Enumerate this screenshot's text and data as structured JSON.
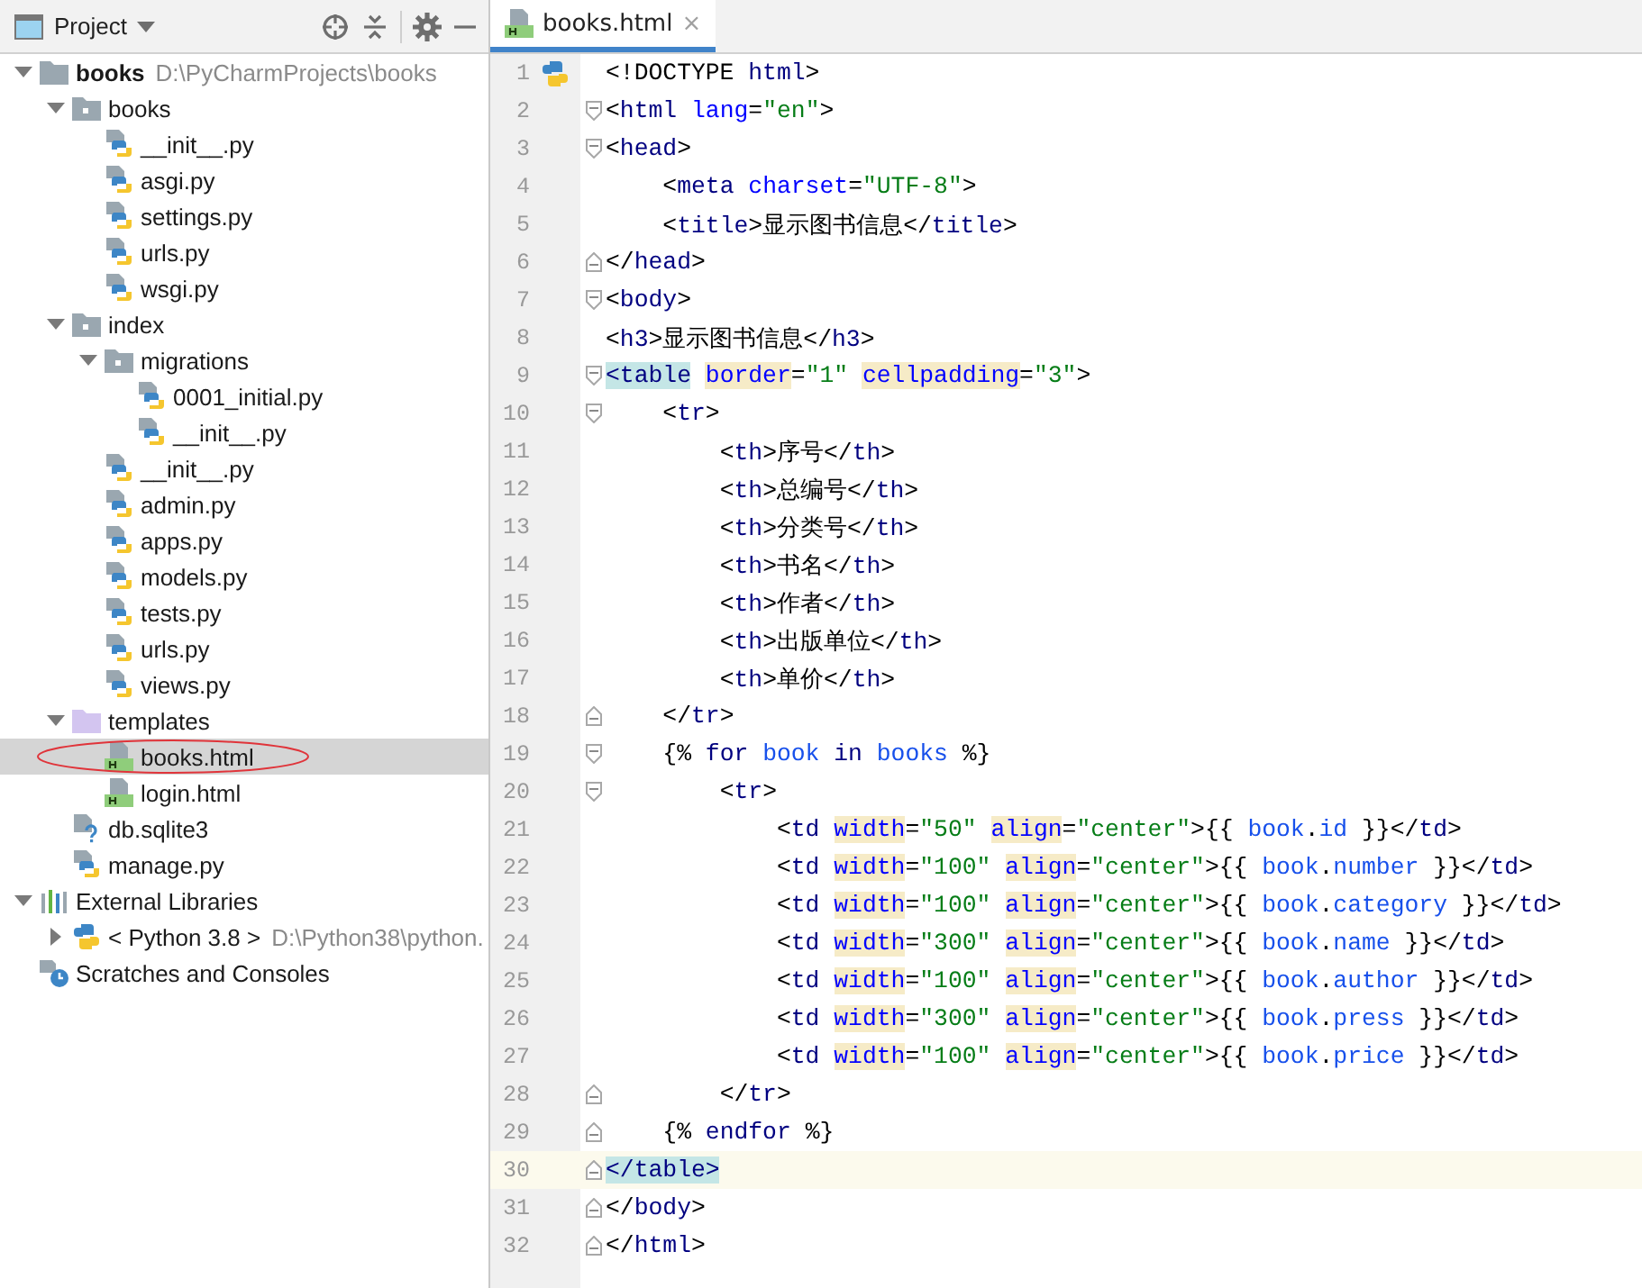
{
  "project_panel": {
    "view_selector": "Project",
    "tree": [
      {
        "label": "books",
        "hint": "D:\\PyCharmProjects\\books",
        "kind": "module",
        "expanded": true,
        "selected": false,
        "circled": false,
        "children": [
          {
            "label": "books",
            "kind": "package",
            "expanded": true,
            "selected": false,
            "circled": false,
            "children": [
              {
                "label": "__init__.py",
                "kind": "python",
                "selected": false,
                "circled": false
              },
              {
                "label": "asgi.py",
                "kind": "python",
                "selected": false,
                "circled": false
              },
              {
                "label": "settings.py",
                "kind": "python",
                "selected": false,
                "circled": false
              },
              {
                "label": "urls.py",
                "kind": "python",
                "selected": false,
                "circled": false
              },
              {
                "label": "wsgi.py",
                "kind": "python",
                "selected": false,
                "circled": false
              }
            ]
          },
          {
            "label": "index",
            "kind": "package",
            "expanded": true,
            "selected": false,
            "circled": false,
            "children": [
              {
                "label": "migrations",
                "kind": "package",
                "expanded": true,
                "selected": false,
                "circled": false,
                "children": [
                  {
                    "label": "0001_initial.py",
                    "kind": "python",
                    "selected": false,
                    "circled": false
                  },
                  {
                    "label": "__init__.py",
                    "kind": "python",
                    "selected": false,
                    "circled": false
                  }
                ]
              },
              {
                "label": "__init__.py",
                "kind": "python",
                "selected": false,
                "circled": false
              },
              {
                "label": "admin.py",
                "kind": "python",
                "selected": false,
                "circled": false
              },
              {
                "label": "apps.py",
                "kind": "python",
                "selected": false,
                "circled": false
              },
              {
                "label": "models.py",
                "kind": "python",
                "selected": false,
                "circled": false
              },
              {
                "label": "tests.py",
                "kind": "python",
                "selected": false,
                "circled": false
              },
              {
                "label": "urls.py",
                "kind": "python",
                "selected": false,
                "circled": false
              },
              {
                "label": "views.py",
                "kind": "python",
                "selected": false,
                "circled": false
              }
            ]
          },
          {
            "label": "templates",
            "kind": "templates",
            "expanded": true,
            "selected": false,
            "circled": false,
            "children": [
              {
                "label": "books.html",
                "kind": "html",
                "selected": true,
                "circled": true
              },
              {
                "label": "login.html",
                "kind": "html",
                "selected": false,
                "circled": false
              }
            ]
          },
          {
            "label": "db.sqlite3",
            "kind": "unknown",
            "selected": false,
            "circled": false
          },
          {
            "label": "manage.py",
            "kind": "python",
            "selected": false,
            "circled": false
          }
        ]
      },
      {
        "label": "External Libraries",
        "kind": "libraries",
        "expanded": true,
        "selected": false,
        "circled": false,
        "children": [
          {
            "label": "< Python 3.8 >",
            "hint": "D:\\Python38\\python.",
            "kind": "sdk",
            "expanded": false,
            "selected": false,
            "circled": false
          }
        ]
      },
      {
        "label": "Scratches and Consoles",
        "kind": "scratches",
        "selected": false,
        "circled": false
      }
    ]
  },
  "editor": {
    "tabs": [
      {
        "label": "books.html",
        "close": "×",
        "selected": true
      }
    ],
    "lines": [
      {
        "number": "1",
        "current": false,
        "gutter": [
          {
            "kind": "python"
          }
        ],
        "tokens": [
          {
            "kind": "plain",
            "text": "<!DOCTYPE "
          },
          {
            "kind": "tag",
            "text": "html"
          },
          {
            "kind": "plain",
            "text": ">"
          }
        ]
      },
      {
        "number": "2",
        "current": false,
        "gutter": [
          {
            "kind": "fold-start"
          }
        ],
        "tokens": [
          {
            "kind": "plain",
            "text": "<"
          },
          {
            "kind": "tag",
            "text": "html "
          },
          {
            "kind": "attr",
            "text": "lang"
          },
          {
            "kind": "plain",
            "text": "="
          },
          {
            "kind": "value",
            "text": "\"en\""
          },
          {
            "kind": "plain",
            "text": ">"
          }
        ]
      },
      {
        "number": "3",
        "current": false,
        "gutter": [
          {
            "kind": "fold-start"
          }
        ],
        "tokens": [
          {
            "kind": "plain",
            "text": "<"
          },
          {
            "kind": "tag",
            "text": "head"
          },
          {
            "kind": "plain",
            "text": ">"
          }
        ]
      },
      {
        "number": "4",
        "current": false,
        "tokens": [
          {
            "kind": "plain",
            "text": "    <"
          },
          {
            "kind": "tag",
            "text": "meta "
          },
          {
            "kind": "attr",
            "text": "charset"
          },
          {
            "kind": "plain",
            "text": "="
          },
          {
            "kind": "value",
            "text": "\"UTF-8\""
          },
          {
            "kind": "plain",
            "text": ">"
          }
        ]
      },
      {
        "number": "5",
        "current": false,
        "tokens": [
          {
            "kind": "plain",
            "text": "    <"
          },
          {
            "kind": "tag",
            "text": "title"
          },
          {
            "kind": "plain",
            "text": ">显示图书信息</"
          },
          {
            "kind": "tag",
            "text": "title"
          },
          {
            "kind": "plain",
            "text": ">"
          }
        ]
      },
      {
        "number": "6",
        "current": false,
        "gutter": [
          {
            "kind": "fold-end"
          }
        ],
        "tokens": [
          {
            "kind": "plain",
            "text": "</"
          },
          {
            "kind": "tag",
            "text": "head"
          },
          {
            "kind": "plain",
            "text": ">"
          }
        ]
      },
      {
        "number": "7",
        "current": false,
        "gutter": [
          {
            "kind": "fold-start"
          }
        ],
        "tokens": [
          {
            "kind": "plain",
            "text": "<"
          },
          {
            "kind": "tag",
            "text": "body"
          },
          {
            "kind": "plain",
            "text": ">"
          }
        ]
      },
      {
        "number": "8",
        "current": false,
        "tokens": [
          {
            "kind": "plain",
            "text": "<"
          },
          {
            "kind": "tag",
            "text": "h3"
          },
          {
            "kind": "plain",
            "text": ">显示图书信息</"
          },
          {
            "kind": "tag",
            "text": "h3"
          },
          {
            "kind": "plain",
            "text": ">"
          }
        ]
      },
      {
        "number": "9",
        "current": false,
        "gutter": [
          {
            "kind": "fold-start"
          }
        ],
        "tokens": [
          {
            "kind": "matched",
            "text": "<table"
          },
          {
            "kind": "attr-marked",
            "text": " border"
          },
          {
            "kind": "plain",
            "text": "="
          },
          {
            "kind": "value",
            "text": "\"1\" "
          },
          {
            "kind": "attr-marked",
            "text": "cellpadding"
          },
          {
            "kind": "plain",
            "text": "="
          },
          {
            "kind": "value",
            "text": "\"3\""
          },
          {
            "kind": "plain",
            "text": ">"
          }
        ]
      },
      {
        "number": "10",
        "current": false,
        "gutter": [
          {
            "kind": "fold-start"
          }
        ],
        "tokens": [
          {
            "kind": "plain",
            "text": "    <"
          },
          {
            "kind": "tag",
            "text": "tr"
          },
          {
            "kind": "plain",
            "text": ">"
          }
        ]
      },
      {
        "number": "11",
        "current": false,
        "tokens": [
          {
            "kind": "plain",
            "text": "        <"
          },
          {
            "kind": "tag",
            "text": "th"
          },
          {
            "kind": "plain",
            "text": ">序号</"
          },
          {
            "kind": "tag",
            "text": "th"
          },
          {
            "kind": "plain",
            "text": ">"
          }
        ]
      },
      {
        "number": "12",
        "current": false,
        "tokens": [
          {
            "kind": "plain",
            "text": "        <"
          },
          {
            "kind": "tag",
            "text": "th"
          },
          {
            "kind": "plain",
            "text": ">总编号</"
          },
          {
            "kind": "tag",
            "text": "th"
          },
          {
            "kind": "plain",
            "text": ">"
          }
        ]
      },
      {
        "number": "13",
        "current": false,
        "tokens": [
          {
            "kind": "plain",
            "text": "        <"
          },
          {
            "kind": "tag",
            "text": "th"
          },
          {
            "kind": "plain",
            "text": ">分类号</"
          },
          {
            "kind": "tag",
            "text": "th"
          },
          {
            "kind": "plain",
            "text": ">"
          }
        ]
      },
      {
        "number": "14",
        "current": false,
        "tokens": [
          {
            "kind": "plain",
            "text": "        <"
          },
          {
            "kind": "tag",
            "text": "th"
          },
          {
            "kind": "plain",
            "text": ">书名</"
          },
          {
            "kind": "tag",
            "text": "th"
          },
          {
            "kind": "plain",
            "text": ">"
          }
        ]
      },
      {
        "number": "15",
        "current": false,
        "tokens": [
          {
            "kind": "plain",
            "text": "        <"
          },
          {
            "kind": "tag",
            "text": "th"
          },
          {
            "kind": "plain",
            "text": ">作者</"
          },
          {
            "kind": "tag",
            "text": "th"
          },
          {
            "kind": "plain",
            "text": ">"
          }
        ]
      },
      {
        "number": "16",
        "current": false,
        "tokens": [
          {
            "kind": "plain",
            "text": "        <"
          },
          {
            "kind": "tag",
            "text": "th"
          },
          {
            "kind": "plain",
            "text": ">出版单位</"
          },
          {
            "kind": "tag",
            "text": "th"
          },
          {
            "kind": "plain",
            "text": ">"
          }
        ]
      },
      {
        "number": "17",
        "current": false,
        "tokens": [
          {
            "kind": "plain",
            "text": "        <"
          },
          {
            "kind": "tag",
            "text": "th"
          },
          {
            "kind": "plain",
            "text": ">单价</"
          },
          {
            "kind": "tag",
            "text": "th"
          },
          {
            "kind": "plain",
            "text": ">"
          }
        ]
      },
      {
        "number": "18",
        "current": false,
        "gutter": [
          {
            "kind": "fold-end"
          }
        ],
        "tokens": [
          {
            "kind": "plain",
            "text": "    </"
          },
          {
            "kind": "tag",
            "text": "tr"
          },
          {
            "kind": "plain",
            "text": ">"
          }
        ]
      },
      {
        "number": "19",
        "current": false,
        "gutter": [
          {
            "kind": "fold-start"
          }
        ],
        "tokens": [
          {
            "kind": "plain",
            "text": "    {% "
          },
          {
            "kind": "keyword",
            "text": "for "
          },
          {
            "kind": "variable",
            "text": "book "
          },
          {
            "kind": "keyword",
            "text": "in "
          },
          {
            "kind": "variable",
            "text": "books"
          },
          {
            "kind": "plain",
            "text": " %}"
          }
        ]
      },
      {
        "number": "20",
        "current": false,
        "gutter": [
          {
            "kind": "fold-start"
          }
        ],
        "tokens": [
          {
            "kind": "plain",
            "text": "        <"
          },
          {
            "kind": "tag",
            "text": "tr"
          },
          {
            "kind": "plain",
            "text": ">"
          }
        ]
      },
      {
        "number": "21",
        "current": false,
        "tokens": [
          {
            "kind": "plain",
            "text": "            <"
          },
          {
            "kind": "tag",
            "text": "td "
          },
          {
            "kind": "attr-marked",
            "text": "width"
          },
          {
            "kind": "plain",
            "text": "="
          },
          {
            "kind": "value",
            "text": "\"50\" "
          },
          {
            "kind": "attr-marked",
            "text": "align"
          },
          {
            "kind": "plain",
            "text": "="
          },
          {
            "kind": "value",
            "text": "\"center\""
          },
          {
            "kind": "plain",
            "text": ">{{ "
          },
          {
            "kind": "variable",
            "text": "book"
          },
          {
            "kind": "plain",
            "text": "."
          },
          {
            "kind": "variable",
            "text": "id"
          },
          {
            "kind": "plain",
            "text": " }}</"
          },
          {
            "kind": "tag",
            "text": "td"
          },
          {
            "kind": "plain",
            "text": ">"
          }
        ]
      },
      {
        "number": "22",
        "current": false,
        "tokens": [
          {
            "kind": "plain",
            "text": "            <"
          },
          {
            "kind": "tag",
            "text": "td "
          },
          {
            "kind": "attr-marked",
            "text": "width"
          },
          {
            "kind": "plain",
            "text": "="
          },
          {
            "kind": "value",
            "text": "\"100\" "
          },
          {
            "kind": "attr-marked",
            "text": "align"
          },
          {
            "kind": "plain",
            "text": "="
          },
          {
            "kind": "value",
            "text": "\"center\""
          },
          {
            "kind": "plain",
            "text": ">{{ "
          },
          {
            "kind": "variable",
            "text": "book"
          },
          {
            "kind": "plain",
            "text": "."
          },
          {
            "kind": "variable",
            "text": "number"
          },
          {
            "kind": "plain",
            "text": " }}</"
          },
          {
            "kind": "tag",
            "text": "td"
          },
          {
            "kind": "plain",
            "text": ">"
          }
        ]
      },
      {
        "number": "23",
        "current": false,
        "tokens": [
          {
            "kind": "plain",
            "text": "            <"
          },
          {
            "kind": "tag",
            "text": "td "
          },
          {
            "kind": "attr-marked",
            "text": "width"
          },
          {
            "kind": "plain",
            "text": "="
          },
          {
            "kind": "value",
            "text": "\"100\" "
          },
          {
            "kind": "attr-marked",
            "text": "align"
          },
          {
            "kind": "plain",
            "text": "="
          },
          {
            "kind": "value",
            "text": "\"center\""
          },
          {
            "kind": "plain",
            "text": ">{{ "
          },
          {
            "kind": "variable",
            "text": "book"
          },
          {
            "kind": "plain",
            "text": "."
          },
          {
            "kind": "variable",
            "text": "category"
          },
          {
            "kind": "plain",
            "text": " }}</"
          },
          {
            "kind": "tag",
            "text": "td"
          },
          {
            "kind": "plain",
            "text": ">"
          }
        ]
      },
      {
        "number": "24",
        "current": false,
        "tokens": [
          {
            "kind": "plain",
            "text": "            <"
          },
          {
            "kind": "tag",
            "text": "td "
          },
          {
            "kind": "attr-marked",
            "text": "width"
          },
          {
            "kind": "plain",
            "text": "="
          },
          {
            "kind": "value",
            "text": "\"300\" "
          },
          {
            "kind": "attr-marked",
            "text": "align"
          },
          {
            "kind": "plain",
            "text": "="
          },
          {
            "kind": "value",
            "text": "\"center\""
          },
          {
            "kind": "plain",
            "text": ">{{ "
          },
          {
            "kind": "variable",
            "text": "book"
          },
          {
            "kind": "plain",
            "text": "."
          },
          {
            "kind": "variable",
            "text": "name"
          },
          {
            "kind": "plain",
            "text": " }}</"
          },
          {
            "kind": "tag",
            "text": "td"
          },
          {
            "kind": "plain",
            "text": ">"
          }
        ]
      },
      {
        "number": "25",
        "current": false,
        "tokens": [
          {
            "kind": "plain",
            "text": "            <"
          },
          {
            "kind": "tag",
            "text": "td "
          },
          {
            "kind": "attr-marked",
            "text": "width"
          },
          {
            "kind": "plain",
            "text": "="
          },
          {
            "kind": "value",
            "text": "\"100\" "
          },
          {
            "kind": "attr-marked",
            "text": "align"
          },
          {
            "kind": "plain",
            "text": "="
          },
          {
            "kind": "value",
            "text": "\"center\""
          },
          {
            "kind": "plain",
            "text": ">{{ "
          },
          {
            "kind": "variable",
            "text": "book"
          },
          {
            "kind": "plain",
            "text": "."
          },
          {
            "kind": "variable",
            "text": "author"
          },
          {
            "kind": "plain",
            "text": " }}</"
          },
          {
            "kind": "tag",
            "text": "td"
          },
          {
            "kind": "plain",
            "text": ">"
          }
        ]
      },
      {
        "number": "26",
        "current": false,
        "tokens": [
          {
            "kind": "plain",
            "text": "            <"
          },
          {
            "kind": "tag",
            "text": "td "
          },
          {
            "kind": "attr-marked",
            "text": "width"
          },
          {
            "kind": "plain",
            "text": "="
          },
          {
            "kind": "value",
            "text": "\"300\" "
          },
          {
            "kind": "attr-marked",
            "text": "align"
          },
          {
            "kind": "plain",
            "text": "="
          },
          {
            "kind": "value",
            "text": "\"center\""
          },
          {
            "kind": "plain",
            "text": ">{{ "
          },
          {
            "kind": "variable",
            "text": "book"
          },
          {
            "kind": "plain",
            "text": "."
          },
          {
            "kind": "variable",
            "text": "press"
          },
          {
            "kind": "plain",
            "text": " }}</"
          },
          {
            "kind": "tag",
            "text": "td"
          },
          {
            "kind": "plain",
            "text": ">"
          }
        ]
      },
      {
        "number": "27",
        "current": false,
        "tokens": [
          {
            "kind": "plain",
            "text": "            <"
          },
          {
            "kind": "tag",
            "text": "td "
          },
          {
            "kind": "attr-marked",
            "text": "width"
          },
          {
            "kind": "plain",
            "text": "="
          },
          {
            "kind": "value",
            "text": "\"100\" "
          },
          {
            "kind": "attr-marked",
            "text": "align"
          },
          {
            "kind": "plain",
            "text": "="
          },
          {
            "kind": "value",
            "text": "\"center\""
          },
          {
            "kind": "plain",
            "text": ">{{ "
          },
          {
            "kind": "variable",
            "text": "book"
          },
          {
            "kind": "plain",
            "text": "."
          },
          {
            "kind": "variable",
            "text": "price"
          },
          {
            "kind": "plain",
            "text": " }}</"
          },
          {
            "kind": "tag",
            "text": "td"
          },
          {
            "kind": "plain",
            "text": ">"
          }
        ]
      },
      {
        "number": "28",
        "current": false,
        "gutter": [
          {
            "kind": "fold-end"
          }
        ],
        "tokens": [
          {
            "kind": "plain",
            "text": "        </"
          },
          {
            "kind": "tag",
            "text": "tr"
          },
          {
            "kind": "plain",
            "text": ">"
          }
        ]
      },
      {
        "number": "29",
        "current": false,
        "gutter": [
          {
            "kind": "fold-end"
          }
        ],
        "tokens": [
          {
            "kind": "plain",
            "text": "    {% "
          },
          {
            "kind": "keyword",
            "text": "endfor"
          },
          {
            "kind": "plain",
            "text": " %}"
          }
        ]
      },
      {
        "number": "30",
        "current": true,
        "gutter": [
          {
            "kind": "fold-end"
          }
        ],
        "tokens": [
          {
            "kind": "matched",
            "text": "</table>"
          }
        ]
      },
      {
        "number": "31",
        "current": false,
        "gutter": [
          {
            "kind": "fold-end"
          }
        ],
        "tokens": [
          {
            "kind": "plain",
            "text": "</"
          },
          {
            "kind": "tag",
            "text": "body"
          },
          {
            "kind": "plain",
            "text": ">"
          }
        ]
      },
      {
        "number": "32",
        "current": false,
        "gutter": [
          {
            "kind": "fold-end"
          }
        ],
        "tokens": [
          {
            "kind": "plain",
            "text": "</"
          },
          {
            "kind": "tag",
            "text": "html"
          },
          {
            "kind": "plain",
            "text": ">"
          }
        ]
      }
    ]
  }
}
